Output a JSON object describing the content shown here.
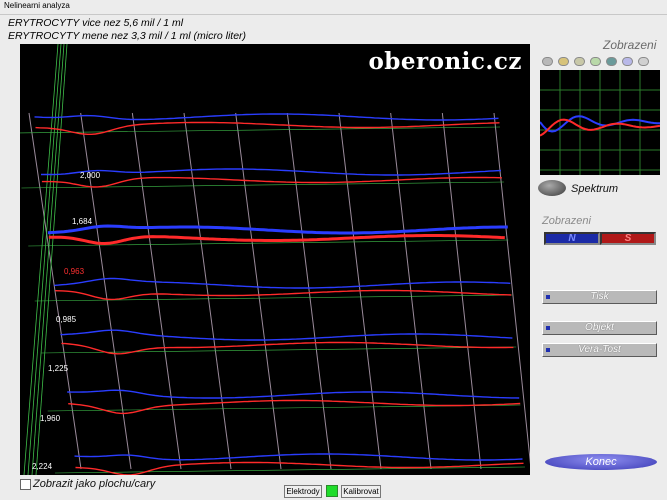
{
  "window": {
    "title": "Nelinearni analyza"
  },
  "info": {
    "line1": "ERYTROCYTY vice nez 5,6 mil / 1 ml",
    "line2": "ERYTROCYTY mene nez 3,3 mil / 1 ml (micro liter)"
  },
  "plot": {
    "logo": "oberonic.cz",
    "row_labels": [
      "2,000",
      "1,684",
      "0,963",
      "0,985",
      "1,225",
      "1,960",
      "2,224"
    ],
    "row_label_colors": [
      "#ffffff",
      "#ffffff",
      "#ff3030",
      "#ffffff",
      "#ffffff",
      "#ffffff",
      "#ffffff"
    ],
    "series_colors": {
      "n": "#2a3dff",
      "s": "#ff2a2a",
      "grid": "#9a8a9a",
      "ygrid": "#3fbf4a"
    }
  },
  "panel": {
    "title": "Zobrazeni",
    "spektrum_label": "Spektrum",
    "display_label": "Zobrazeni",
    "n_label": "N",
    "s_label": "S",
    "buttons": {
      "tisk": "Tisk",
      "objekt": "Objekt",
      "vera": "Vera-Tost"
    },
    "konec": "Konec",
    "icon_colors": [
      "#b8b8b8",
      "#d7c37a",
      "#c8c8a8",
      "#b9d9a9",
      "#6a9a9a",
      "#b8b8e8",
      "#d0d0d0"
    ]
  },
  "footer": {
    "checkbox_label": "Zobrazit jako plochu/cary",
    "elektrody": "Elektrody",
    "kalibrovat": "Kalibrovat"
  }
}
